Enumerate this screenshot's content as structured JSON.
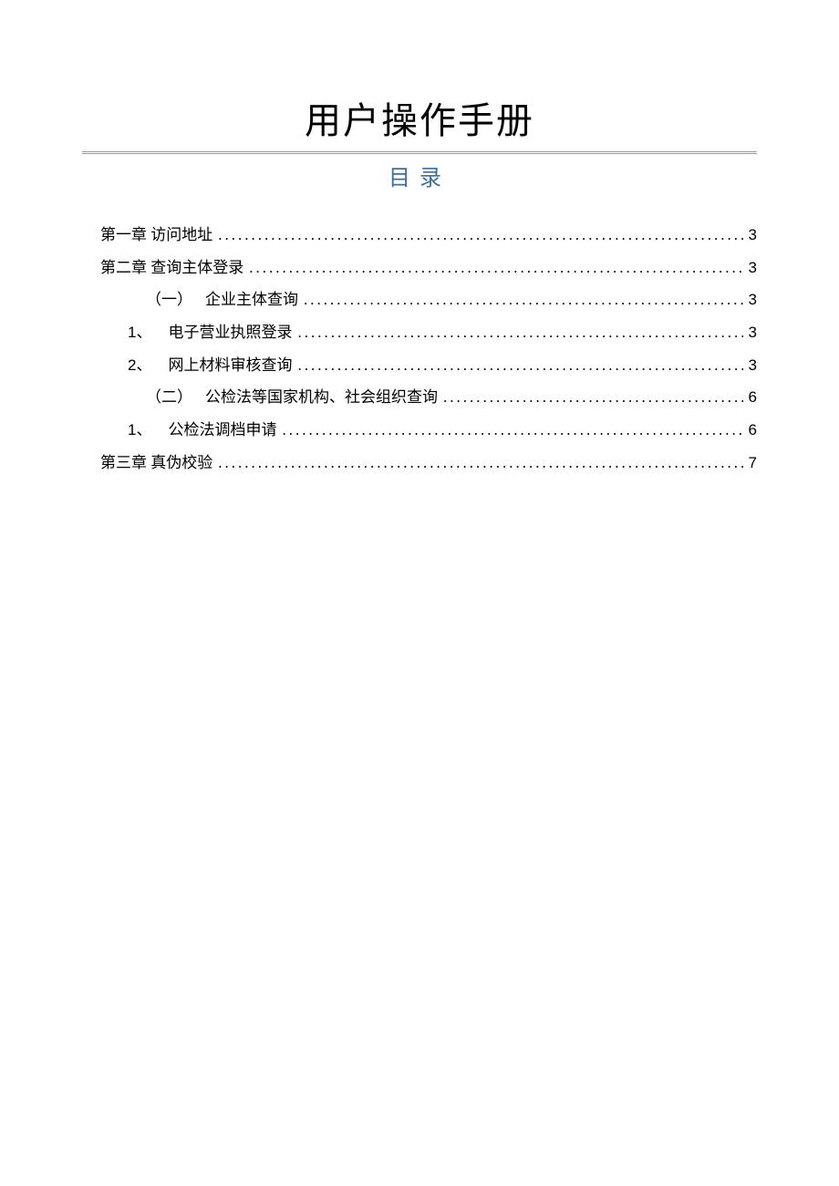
{
  "title": "用户操作手册",
  "toc_heading": "目录",
  "toc": {
    "items": [
      {
        "level": 1,
        "num": "",
        "label": "第一章 访问地址",
        "page": "3"
      },
      {
        "level": 1,
        "num": "",
        "label": "第二章 查询主体登录",
        "page": "3"
      },
      {
        "level": 2,
        "num": "（一）",
        "label": "企业主体查询",
        "page": "3"
      },
      {
        "level": 3,
        "num": "1、",
        "label": "电子营业执照登录",
        "page": "3"
      },
      {
        "level": 3,
        "num": "2、",
        "label": "网上材料审核查询",
        "page": "3"
      },
      {
        "level": 2,
        "num": "（二）",
        "label": "公检法等国家机构、社会组织查询",
        "page": "6"
      },
      {
        "level": 3,
        "num": "1、",
        "label": "公检法调档申请",
        "page": "6"
      },
      {
        "level": 1,
        "num": "",
        "label": "第三章 真伪校验",
        "page": "7"
      }
    ]
  }
}
